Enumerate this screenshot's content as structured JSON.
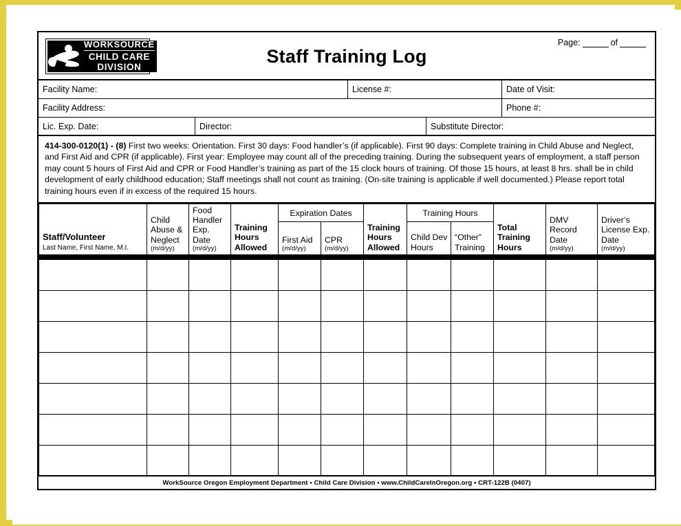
{
  "page": {
    "border_color": "#e3cf3f",
    "background": "#ffffff"
  },
  "header": {
    "title": "Staff Training Log",
    "logo": {
      "line1": "WORKSOURCE",
      "line2": "CHILD CARE",
      "line3": "DIVISION",
      "icon": "worksource-runner-logo"
    },
    "page_label": "Page:",
    "page_of": "of"
  },
  "info": {
    "facility_name": "Facility Name:",
    "license_number": "License #:",
    "date_of_visit": "Date of Visit:",
    "facility_address": "Facility Address:",
    "phone_number": "Phone #:",
    "lic_exp_date": "Lic. Exp. Date:",
    "director": "Director:",
    "substitute_director": "Substitute Director:"
  },
  "regulation": {
    "rule_number": "414-300-0120(1) - (8)",
    "text": " First two weeks: Orientation. First 30 days: Food handler’s (if applicable). First 90 days: Complete training in Child Abuse and Neglect, and First Aid and CPR (if applicable). First year: Employee may count all of the preceding training. During the subsequent years of employment, a staff person may count 5 hours of First Aid and CPR or Food Handler’s training as part of the 15 clock hours of training. Of those 15 hours, at least 8 hrs. shall be in child development of early childhood education; Staff meetings shall not count as training. (On-site training is applicable if well documented.) Please report total training hours even if in excess of the required 15 hours."
  },
  "table": {
    "group_headers": {
      "expiration_dates": "Expiration Dates",
      "training_hours": "Training Hours"
    },
    "columns": [
      {
        "label": "Staff/Volunteer",
        "sub": "Last Name, First Name, M.I.",
        "bold": true
      },
      {
        "label": "Child Abuse & Neglect",
        "sub": "(m/d/yy)",
        "bold": false
      },
      {
        "label": "Food Handler Exp. Date",
        "sub": "(m/d/yy)",
        "bold": false
      },
      {
        "label": "Training Hours Allowed",
        "sub": "",
        "bold": true
      },
      {
        "label": "First Aid",
        "sub": "(m/d/yy)",
        "bold": false
      },
      {
        "label": "CPR",
        "sub": "(m/d/yy)",
        "bold": false
      },
      {
        "label": "Training Hours Allowed",
        "sub": "",
        "bold": true
      },
      {
        "label": "Child Dev Hours",
        "sub": "",
        "bold": false
      },
      {
        "label": "“Other” Training",
        "sub": "",
        "bold": false
      },
      {
        "label": "Total Training Hours",
        "sub": "",
        "bold": true
      },
      {
        "label": "DMV Record Date",
        "sub": "(m/d/yy)",
        "bold": false
      },
      {
        "label": "Driver’s License Exp. Date",
        "sub": "(m/d/yy)",
        "bold": false
      }
    ],
    "row_count": 7,
    "rows": [
      [
        "",
        "",
        "",
        "",
        "",
        "",
        "",
        "",
        "",
        "",
        "",
        ""
      ],
      [
        "",
        "",
        "",
        "",
        "",
        "",
        "",
        "",
        "",
        "",
        "",
        ""
      ],
      [
        "",
        "",
        "",
        "",
        "",
        "",
        "",
        "",
        "",
        "",
        "",
        ""
      ],
      [
        "",
        "",
        "",
        "",
        "",
        "",
        "",
        "",
        "",
        "",
        "",
        ""
      ],
      [
        "",
        "",
        "",
        "",
        "",
        "",
        "",
        "",
        "",
        "",
        "",
        ""
      ],
      [
        "",
        "",
        "",
        "",
        "",
        "",
        "",
        "",
        "",
        "",
        "",
        ""
      ],
      [
        "",
        "",
        "",
        "",
        "",
        "",
        "",
        "",
        "",
        "",
        "",
        ""
      ]
    ]
  },
  "footer": {
    "text": "WorkSource Oregon Employment Department • Child Care Division • www.ChildCareInOregon.org • CRT-122B (0407)"
  }
}
